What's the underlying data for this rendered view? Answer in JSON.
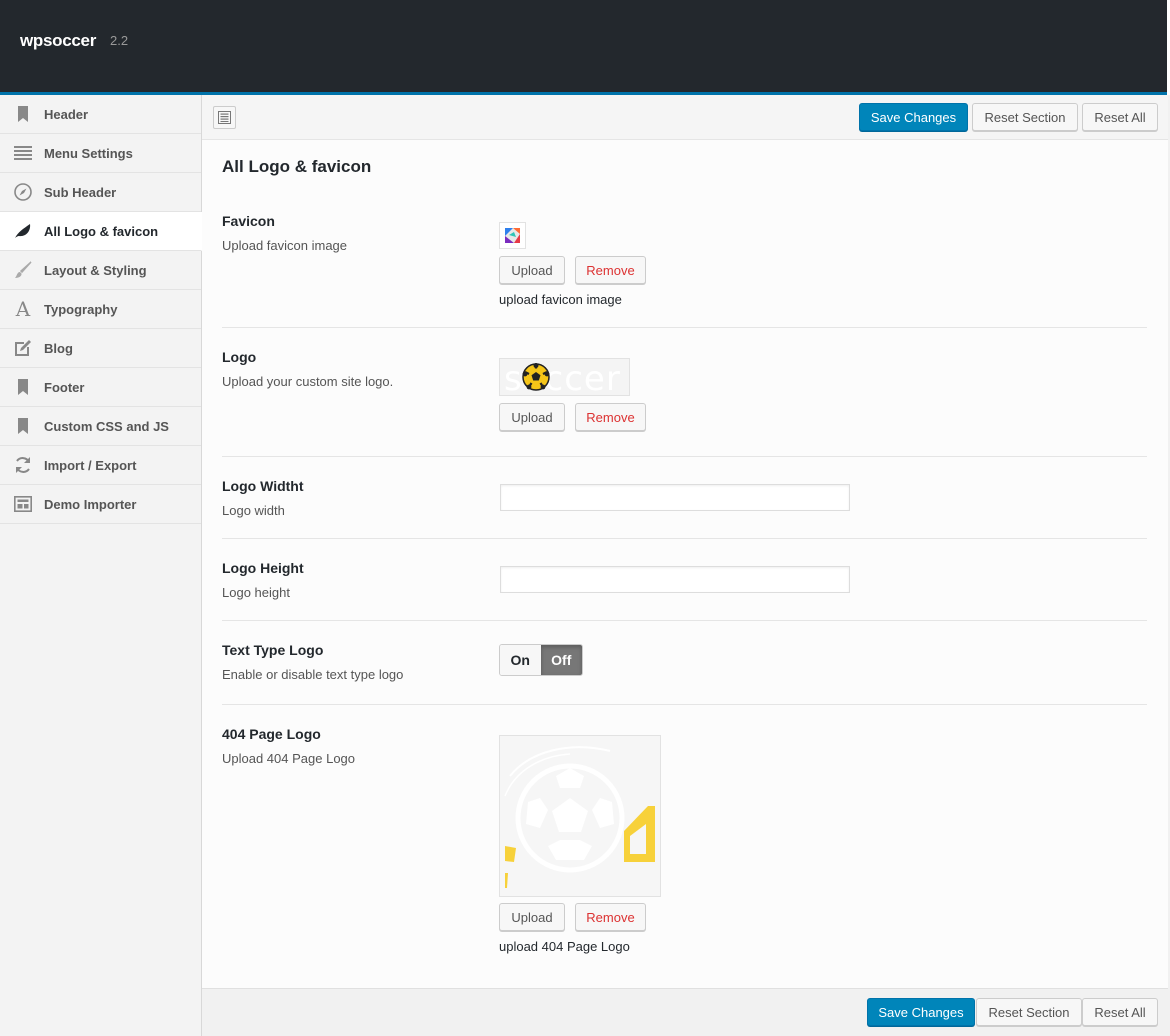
{
  "app": {
    "name": "wpsoccer",
    "version": "2.2"
  },
  "sidebar": {
    "items": [
      {
        "label": "Header",
        "icon": "bookmark-icon",
        "active": false
      },
      {
        "label": "Menu Settings",
        "icon": "list-icon",
        "active": false
      },
      {
        "label": "Sub Header",
        "icon": "compass-icon",
        "active": false
      },
      {
        "label": "All Logo & favicon",
        "icon": "leaf-icon",
        "active": true
      },
      {
        "label": "Layout & Styling",
        "icon": "brush-icon",
        "active": false
      },
      {
        "label": "Typography",
        "icon": "font-icon",
        "active": false
      },
      {
        "label": "Blog",
        "icon": "edit-icon",
        "active": false
      },
      {
        "label": "Footer",
        "icon": "bookmark-icon",
        "active": false
      },
      {
        "label": "Custom CSS and JS",
        "icon": "bookmark-icon",
        "active": false
      },
      {
        "label": "Import / Export",
        "icon": "refresh-icon",
        "active": false
      },
      {
        "label": "Demo Importer",
        "icon": "layout-icon",
        "active": false
      }
    ]
  },
  "toolbar": {
    "save_label": "Save Changes",
    "reset_section_label": "Reset Section",
    "reset_all_label": "Reset All"
  },
  "section": {
    "title": "All Logo & favicon"
  },
  "fields": {
    "favicon": {
      "title": "Favicon",
      "desc": "Upload favicon image",
      "upload_label": "Upload",
      "remove_label": "Remove",
      "help": "upload favicon image"
    },
    "logo": {
      "title": "Logo",
      "desc": "Upload your custom site logo.",
      "upload_label": "Upload",
      "remove_label": "Remove",
      "logo_text": "soccer"
    },
    "logo_width": {
      "title": "Logo Widtht",
      "desc": "Logo width",
      "value": ""
    },
    "logo_height": {
      "title": "Logo Height",
      "desc": "Logo height",
      "value": ""
    },
    "text_logo": {
      "title": "Text Type Logo",
      "desc": "Enable or disable text type logo",
      "on_label": "On",
      "off_label": "Off",
      "state": "off"
    },
    "page404_logo": {
      "title": "404 Page Logo",
      "desc": "Upload 404 Page Logo",
      "upload_label": "Upload",
      "remove_label": "Remove",
      "help": "upload 404 Page Logo"
    }
  },
  "colors": {
    "topbar": "#23282d",
    "accent": "#0085ba",
    "remove": "#dc3232",
    "ball_yellow": "#f5c518",
    "highlight_yellow": "#f7d13a"
  }
}
